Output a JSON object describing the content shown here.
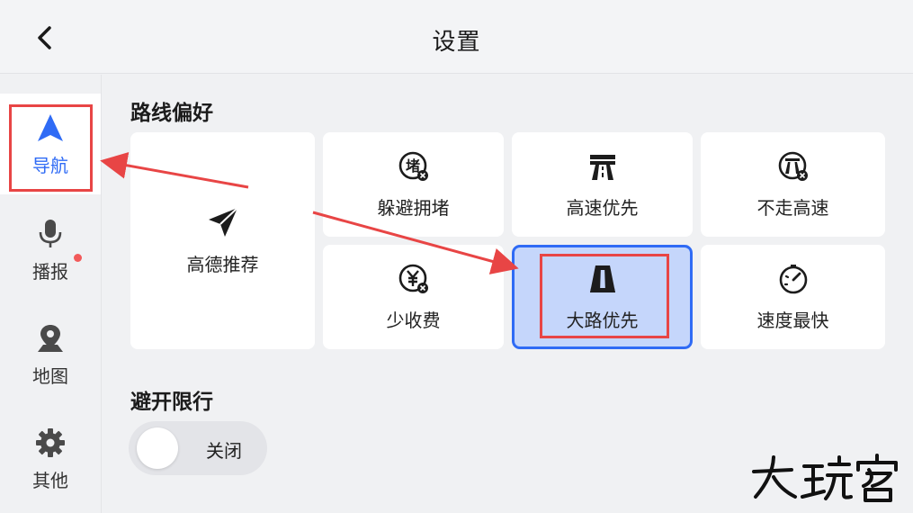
{
  "header": {
    "title": "设置"
  },
  "sidebar": {
    "items": [
      {
        "label": "导航",
        "icon": "navigation-arrow-icon",
        "active": true
      },
      {
        "label": "播报",
        "icon": "microphone-icon",
        "active": false
      },
      {
        "label": "地图",
        "icon": "map-pin-icon",
        "active": false,
        "has_dot": true
      },
      {
        "label": "其他",
        "icon": "gear-icon",
        "active": false
      }
    ]
  },
  "route_pref": {
    "title": "路线偏好",
    "options": [
      {
        "label": "高德推荐",
        "icon": "paper-plane-icon",
        "selected": false
      },
      {
        "label": "躲避拥堵",
        "icon": "avoid-congestion-icon",
        "selected": false
      },
      {
        "label": "高速优先",
        "icon": "highway-icon",
        "selected": false
      },
      {
        "label": "不走高速",
        "icon": "no-highway-icon",
        "selected": false
      },
      {
        "label": "少收费",
        "icon": "less-toll-icon",
        "selected": false
      },
      {
        "label": "大路优先",
        "icon": "main-road-icon",
        "selected": true
      },
      {
        "label": "速度最快",
        "icon": "speedometer-icon",
        "selected": false
      }
    ]
  },
  "restriction": {
    "title": "避开限行",
    "toggle_label": "关闭",
    "toggle_on": false
  },
  "watermark": {
    "text": "大玩客"
  },
  "colors": {
    "accent": "#2f6bf5",
    "selected_bg": "#c5d6fb",
    "annotation": "#e84545",
    "badge_dot": "#f25a5a"
  }
}
